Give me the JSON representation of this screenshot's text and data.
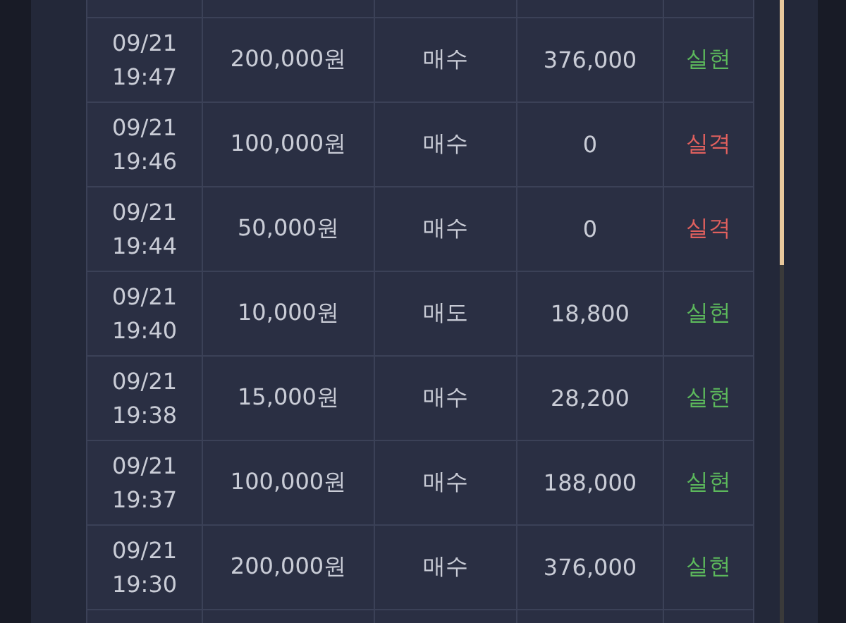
{
  "rows": [
    {
      "time_date": "09/21",
      "time_clock": "19:47",
      "amount": "200,000원",
      "side": "매수",
      "payout": "376,000",
      "result": "실현",
      "color": "#5cb85c"
    },
    {
      "time_date": "09/21",
      "time_clock": "19:46",
      "amount": "100,000원",
      "side": "매수",
      "payout": "0",
      "result": "실격",
      "color": "#e0605e"
    },
    {
      "time_date": "09/21",
      "time_clock": "19:44",
      "amount": "50,000원",
      "side": "매수",
      "payout": "0",
      "result": "실격",
      "color": "#e0605e"
    },
    {
      "time_date": "09/21",
      "time_clock": "19:40",
      "amount": "10,000원",
      "side": "매도",
      "payout": "18,800",
      "result": "실현",
      "color": "#5cb85c"
    },
    {
      "time_date": "09/21",
      "time_clock": "19:38",
      "amount": "15,000원",
      "side": "매수",
      "payout": "28,200",
      "result": "실현",
      "color": "#5cb85c"
    },
    {
      "time_date": "09/21",
      "time_clock": "19:37",
      "amount": "100,000원",
      "side": "매수",
      "payout": "188,000",
      "result": "실현",
      "color": "#5cb85c"
    },
    {
      "time_date": "09/21",
      "time_clock": "19:30",
      "amount": "200,000원",
      "side": "매수",
      "payout": "376,000",
      "result": "실현",
      "color": "#5cb85c"
    }
  ]
}
